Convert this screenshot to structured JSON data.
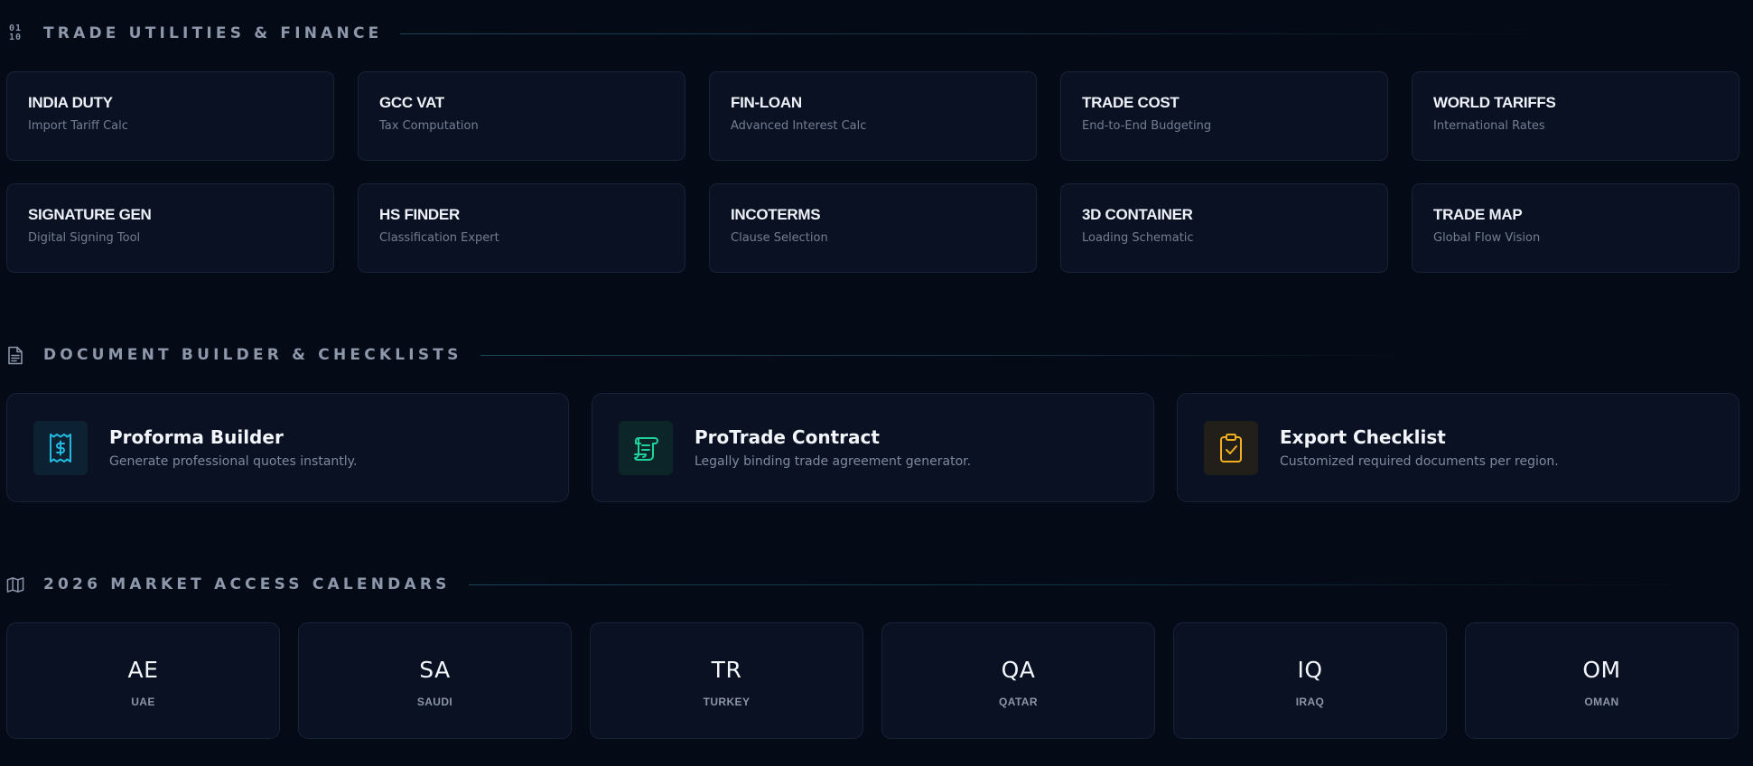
{
  "sections": {
    "utilities": {
      "title": "TRADE UTILITIES & FINANCE",
      "icon": "binary-icon",
      "items": [
        {
          "title": "INDIA DUTY",
          "subtitle": "Import Tariff Calc"
        },
        {
          "title": "GCC VAT",
          "subtitle": "Tax Computation"
        },
        {
          "title": "FIN-LOAN",
          "subtitle": "Advanced Interest Calc"
        },
        {
          "title": "TRADE COST",
          "subtitle": "End-to-End Budgeting"
        },
        {
          "title": "WORLD TARIFFS",
          "subtitle": "International Rates"
        },
        {
          "title": "SIGNATURE GEN",
          "subtitle": "Digital Signing Tool"
        },
        {
          "title": "HS FINDER",
          "subtitle": "Classification Expert"
        },
        {
          "title": "INCOTERMS",
          "subtitle": "Clause Selection"
        },
        {
          "title": "3D CONTAINER",
          "subtitle": "Loading Schematic"
        },
        {
          "title": "TRADE MAP",
          "subtitle": "Global Flow Vision"
        }
      ]
    },
    "documents": {
      "title": "DOCUMENT BUILDER & CHECKLISTS",
      "icon": "document-icon",
      "items": [
        {
          "title": "Proforma Builder",
          "subtitle": "Generate professional quotes instantly.",
          "icon": "receipt-dollar-icon",
          "accent": "#22b8e0"
        },
        {
          "title": "ProTrade Contract",
          "subtitle": "Legally binding trade agreement generator.",
          "icon": "scroll-icon",
          "accent": "#1fd39a"
        },
        {
          "title": "Export Checklist",
          "subtitle": "Customized required documents per region.",
          "icon": "clipboard-check-icon",
          "accent": "#f2b01e"
        }
      ]
    },
    "calendars": {
      "title": "2026 MARKET ACCESS CALENDARS",
      "icon": "map-icon",
      "items": [
        {
          "code": "AE",
          "name": "UAE"
        },
        {
          "code": "SA",
          "name": "SAUDI"
        },
        {
          "code": "TR",
          "name": "TURKEY"
        },
        {
          "code": "QA",
          "name": "QATAR"
        },
        {
          "code": "IQ",
          "name": "IRAQ"
        },
        {
          "code": "OM",
          "name": "OMAN"
        }
      ]
    }
  },
  "colors": {
    "background": "#050a17",
    "card": "#0a1122",
    "border": "#182338",
    "section_title": "#8d98ab",
    "muted_text": "#737e92"
  }
}
